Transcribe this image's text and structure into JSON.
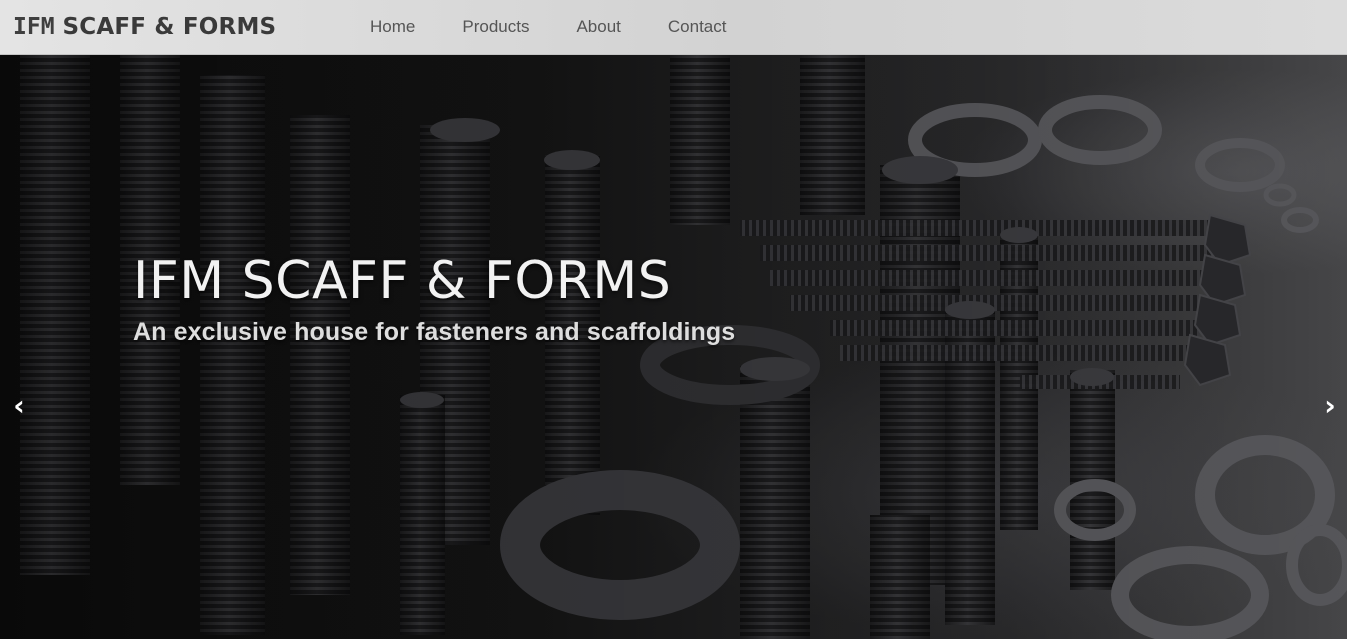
{
  "navbar": {
    "brand_prefix": "IFM",
    "brand_rest": "SCAFF & FORMS",
    "links": [
      {
        "label": "Home"
      },
      {
        "label": "Products"
      },
      {
        "label": "About"
      },
      {
        "label": "Contact"
      }
    ]
  },
  "hero": {
    "title": "IFM SCAFF & FORMS",
    "subtitle": "An exclusive house for fasteners and scaffoldings",
    "prev_icon": "‹",
    "next_icon": "›"
  }
}
